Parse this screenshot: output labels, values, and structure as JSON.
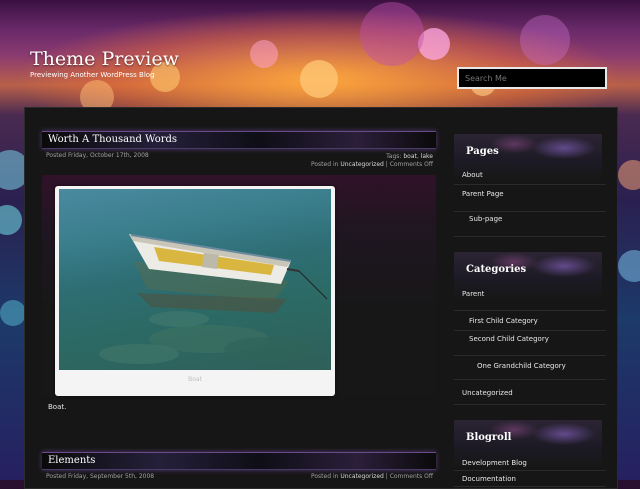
{
  "site": {
    "title": "Theme Preview",
    "description": "Previewing Another WordPress Blog",
    "search_placeholder": "Search Me"
  },
  "posts": [
    {
      "title": "Worth A Thousand Words",
      "posted": "Posted Friday, October 17th, 2008",
      "tags_label": "Tags:",
      "tags": [
        "boat",
        "lake"
      ],
      "category_label": "Posted in",
      "category": "Uncategorized",
      "comments": "Comments Off",
      "image_caption": "Boat",
      "excerpt": "Boat."
    },
    {
      "title": "Elements",
      "posted": "Posted Friday, September 5th, 2008",
      "category_label": "Posted in",
      "category": "Uncategorized",
      "comments": "Comments Off"
    }
  ],
  "sidebar": {
    "pages": {
      "title": "Pages",
      "items": [
        {
          "label": "About",
          "level": 0
        },
        {
          "label": "Parent Page",
          "level": 0
        },
        {
          "label": "Sub-page",
          "level": 1
        }
      ]
    },
    "categories": {
      "title": "Categories",
      "items": [
        {
          "label": "Parent",
          "level": 0
        },
        {
          "label": "First Child Category",
          "level": 1
        },
        {
          "label": "Second Child Category",
          "level": 1
        },
        {
          "label": "One Grandchild Category",
          "level": 2
        },
        {
          "label": "Uncategorized",
          "level": 0
        }
      ]
    },
    "blogroll": {
      "title": "Blogroll",
      "items": [
        {
          "label": "Development Blog",
          "level": 0
        },
        {
          "label": "Documentation",
          "level": 0
        }
      ]
    }
  },
  "colors": {
    "text_primary": "#ffffff",
    "meta_text": "#a0a0a0",
    "panel_bg": "#161616",
    "search_bg": "#000000"
  }
}
